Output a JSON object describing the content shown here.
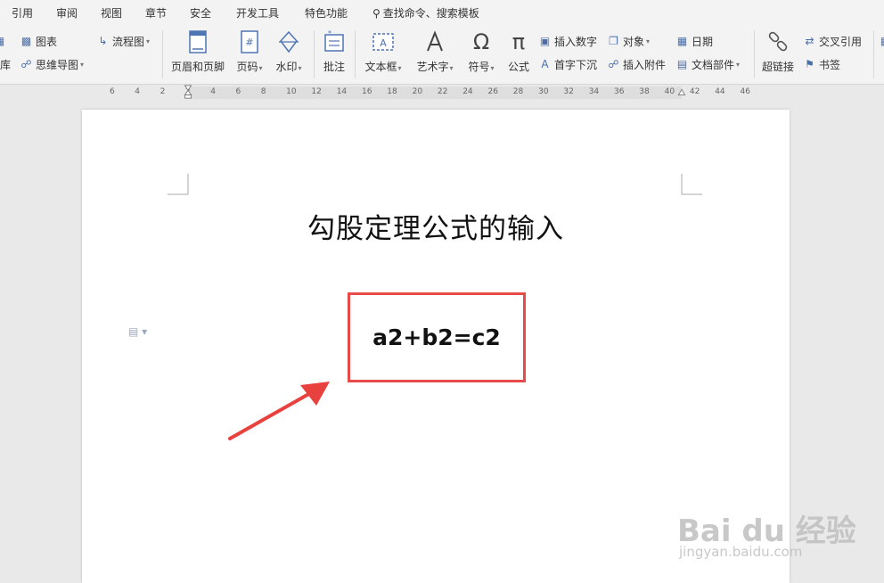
{
  "menubar": {
    "items": [
      "引用",
      "审阅",
      "视图",
      "章节",
      "安全",
      "开发工具",
      "特色功能"
    ],
    "search": "查找命令、搜索模板"
  },
  "ribbon": {
    "lib_label": "库",
    "chart_label": "图表",
    "flowchart_label": "流程图",
    "mindmap_label": "思维导图",
    "header_footer_label": "页眉和页脚",
    "page_number_label": "页码",
    "watermark_label": "水印",
    "comment_label": "批注",
    "textbox_label": "文本框",
    "wordart_label": "艺术字",
    "symbol_label": "符号",
    "formula_label": "公式",
    "insert_number_label": "插入数字",
    "object_label": "对象",
    "date_label": "日期",
    "dropcap_label": "首字下沉",
    "attachment_label": "插入附件",
    "doc_parts_label": "文档部件",
    "hyperlink_label": "超链接",
    "cross_ref_label": "交叉引用",
    "bookmark_label": "书签"
  },
  "ruler": {
    "ticks": [
      "6",
      "4",
      "2",
      "2",
      "4",
      "6",
      "8",
      "10",
      "12",
      "14",
      "16",
      "18",
      "20",
      "22",
      "24",
      "26",
      "28",
      "30",
      "32",
      "34",
      "36",
      "38",
      "40",
      "42",
      "44",
      "46"
    ]
  },
  "document": {
    "title": "勾股定理公式的输入",
    "formula": "a2+b2=c2"
  },
  "colors": {
    "highlight_border": "#e84a4a",
    "arrow": "#e8413e",
    "icon_blue": "#4f74b3"
  },
  "watermark": {
    "brand": "Bai du 经验",
    "url": "jingyan.baidu.com"
  }
}
